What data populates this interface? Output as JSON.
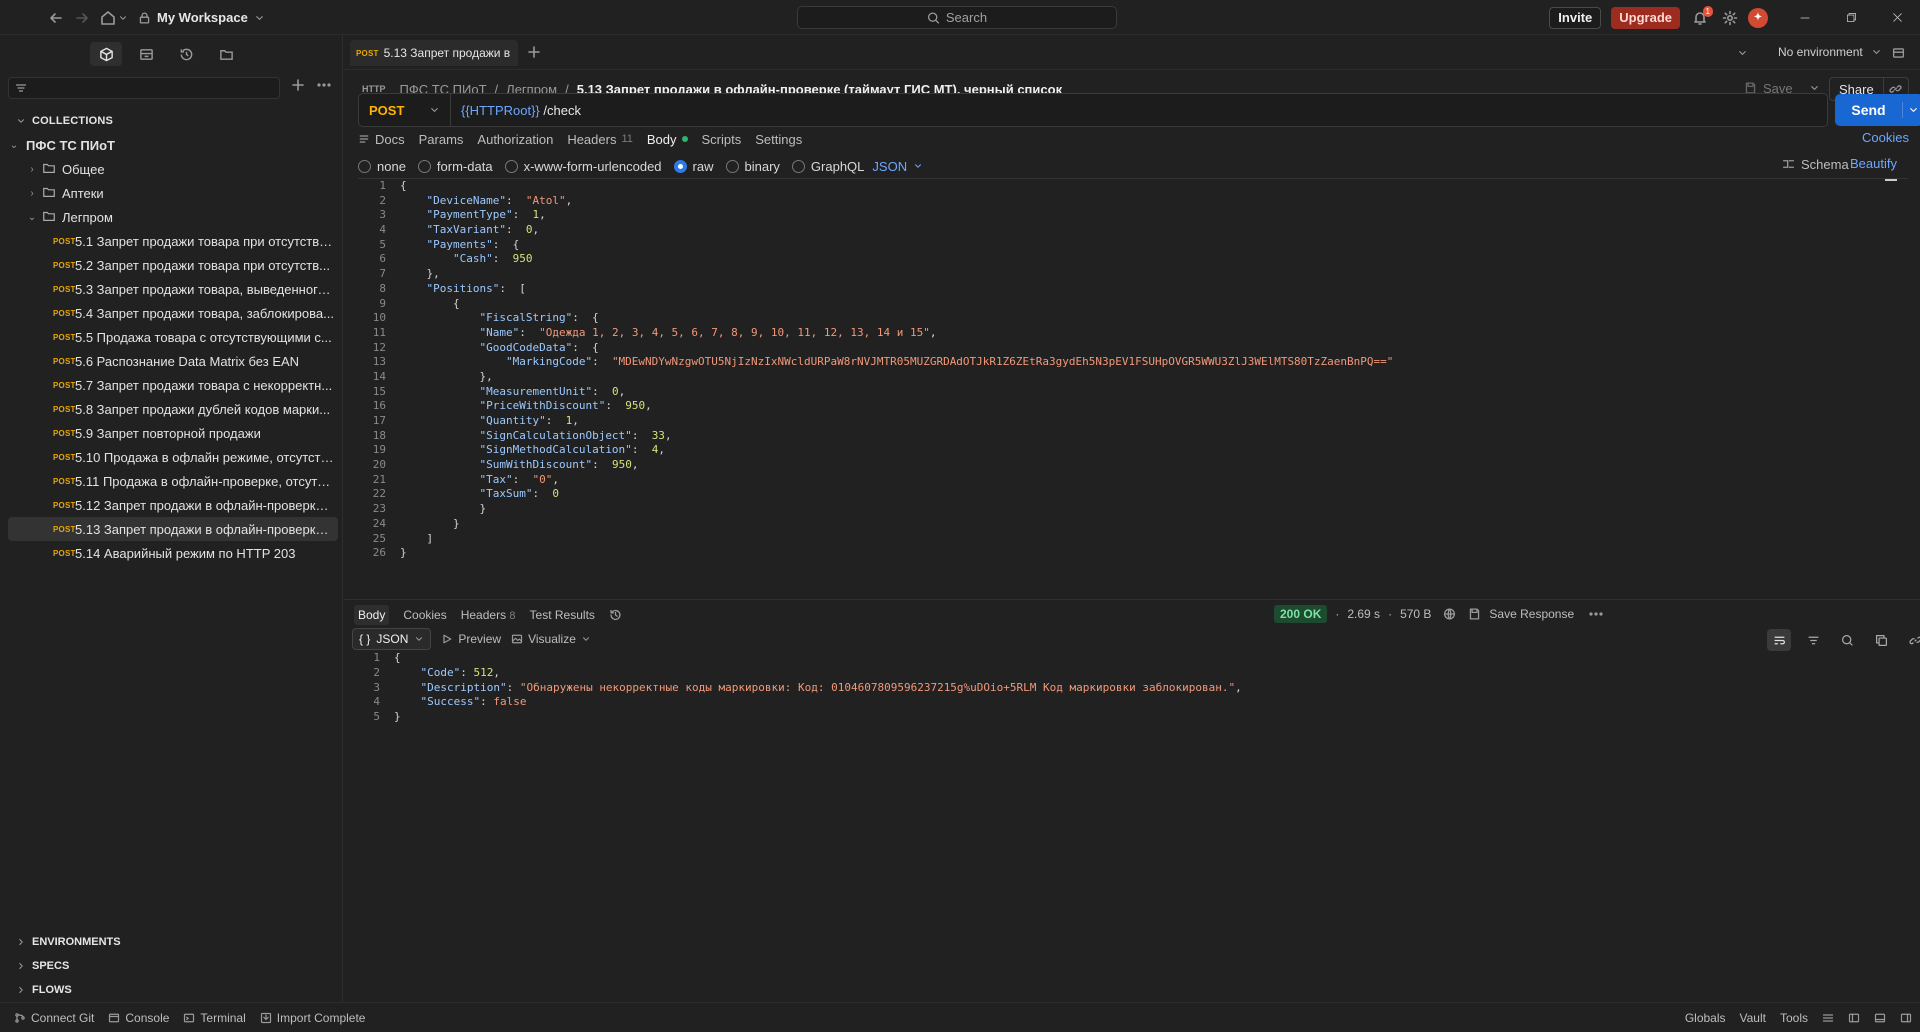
{
  "titlebar": {
    "workspace": "My Workspace",
    "search_placeholder": "Search",
    "invite": "Invite",
    "upgrade": "Upgrade",
    "notification_count": "1"
  },
  "sidebar": {
    "sections": {
      "collections": "COLLECTIONS",
      "environments": "ENVIRONMENTS",
      "specs": "SPECS",
      "flows": "FLOWS"
    },
    "collection_name": "ПФС ТС ПИоТ",
    "folders": [
      "Общее",
      "Аптеки",
      "Легпром"
    ],
    "method_label": "POST",
    "requests": [
      "5.1 Запрет продажи товара при отсутстви...",
      "5.2 Запрет продажи товара при отсутств...",
      "5.3 Запрет продажи товара, выведенного...",
      "5.4 Запрет продажи товара, заблокирова...",
      "5.5 Продажа товара с отсутствующими с...",
      "5.6 Распознание Data Matrix без EAN",
      "5.7 Запрет продажи товара с некорректн...",
      "5.8 Запрет продажи дублей кодов марки...",
      "5.9 Запрет повторной продажи",
      "5.10 Продажа в офлайн режиме, отсутств...",
      "5.11 Продажа в офлайн-проверке, отсутст...",
      "5.12 Запрет продажи в офлайн-проверке,...",
      "5.13 Запрет продажи в офлайн-проверке ...",
      "5.14 Аварийный режим по HTTP 203"
    ]
  },
  "tab": {
    "method": "POST",
    "title": "5.13 Запрет продажи в"
  },
  "environment": "No environment",
  "breadcrumb": {
    "protocol": "HTTP",
    "collection": "ПФС ТС ПИоТ",
    "folder": "Легпром",
    "current": "5.13 Запрет продажи в офлайн-проверке (таймаут ГИС МТ), черный список"
  },
  "actions": {
    "save": "Save",
    "share": "Share",
    "send": "Send",
    "cookies": "Cookies",
    "schema": "Schema",
    "beautify": "Beautify"
  },
  "request": {
    "method": "POST",
    "url_var": "{{HTTPRoot}}",
    "url_path": " /check"
  },
  "request_tabs": {
    "docs": "Docs",
    "params": "Params",
    "authorization": "Authorization",
    "headers": "Headers",
    "headers_count": "11",
    "body": "Body",
    "scripts": "Scripts",
    "settings": "Settings"
  },
  "body_types": {
    "none": "none",
    "form_data": "form-data",
    "urlencoded": "x-www-form-urlencoded",
    "raw": "raw",
    "binary": "binary",
    "graphql": "GraphQL",
    "language": "JSON"
  },
  "request_body": [
    [
      [
        "p",
        "{"
      ]
    ],
    [
      [
        "p",
        "    "
      ],
      [
        "k",
        "\"DeviceName\""
      ],
      [
        "p",
        ":  "
      ],
      [
        "s",
        "\"Atol\""
      ],
      [
        "p",
        ","
      ]
    ],
    [
      [
        "p",
        "    "
      ],
      [
        "k",
        "\"PaymentType\""
      ],
      [
        "p",
        ":  "
      ],
      [
        "n",
        "1"
      ],
      [
        "p",
        ","
      ]
    ],
    [
      [
        "p",
        "    "
      ],
      [
        "k",
        "\"TaxVariant\""
      ],
      [
        "p",
        ":  "
      ],
      [
        "n",
        "0"
      ],
      [
        "p",
        ","
      ]
    ],
    [
      [
        "p",
        "    "
      ],
      [
        "k",
        "\"Payments\""
      ],
      [
        "p",
        ":  {"
      ]
    ],
    [
      [
        "p",
        "        "
      ],
      [
        "k",
        "\"Cash\""
      ],
      [
        "p",
        ":  "
      ],
      [
        "n",
        "950"
      ]
    ],
    [
      [
        "p",
        "    },"
      ]
    ],
    [
      [
        "p",
        "    "
      ],
      [
        "k",
        "\"Positions\""
      ],
      [
        "p",
        ":  ["
      ]
    ],
    [
      [
        "p",
        "        {"
      ]
    ],
    [
      [
        "p",
        "            "
      ],
      [
        "k",
        "\"FiscalString\""
      ],
      [
        "p",
        ":  {"
      ]
    ],
    [
      [
        "p",
        "            "
      ],
      [
        "k",
        "\"Name\""
      ],
      [
        "p",
        ":  "
      ],
      [
        "s",
        "\"Одежда 1, 2, 3, 4, 5, 6, 7, 8, 9, 10, 11, 12, 13, 14 и 15\""
      ],
      [
        "p",
        ","
      ]
    ],
    [
      [
        "p",
        "            "
      ],
      [
        "k",
        "\"GoodCodeData\""
      ],
      [
        "p",
        ":  {"
      ]
    ],
    [
      [
        "p",
        "                "
      ],
      [
        "k",
        "\"MarkingCode\""
      ],
      [
        "p",
        ":  "
      ],
      [
        "s",
        "\"MDEwNDYwNzgwOTU5NjIzNzIxNWcldURPaW8rNVJMTR05MUZGRDAdOTJkR1Z6ZEtRa3gydEh5N3pEV1FSUHpOVGR5WWU3ZlJ3WElMTS80TzZaenBnPQ==\""
      ]
    ],
    [
      [
        "p",
        "            },"
      ]
    ],
    [
      [
        "p",
        "            "
      ],
      [
        "k",
        "\"MeasurementUnit\""
      ],
      [
        "p",
        ":  "
      ],
      [
        "n",
        "0"
      ],
      [
        "p",
        ","
      ]
    ],
    [
      [
        "p",
        "            "
      ],
      [
        "k",
        "\"PriceWithDiscount\""
      ],
      [
        "p",
        ":  "
      ],
      [
        "n",
        "950"
      ],
      [
        "p",
        ","
      ]
    ],
    [
      [
        "p",
        "            "
      ],
      [
        "k",
        "\"Quantity\""
      ],
      [
        "p",
        ":  "
      ],
      [
        "n",
        "1"
      ],
      [
        "p",
        ","
      ]
    ],
    [
      [
        "p",
        "            "
      ],
      [
        "k",
        "\"SignCalculationObject\""
      ],
      [
        "p",
        ":  "
      ],
      [
        "n",
        "33"
      ],
      [
        "p",
        ","
      ]
    ],
    [
      [
        "p",
        "            "
      ],
      [
        "k",
        "\"SignMethodCalculation\""
      ],
      [
        "p",
        ":  "
      ],
      [
        "n",
        "4"
      ],
      [
        "p",
        ","
      ]
    ],
    [
      [
        "p",
        "            "
      ],
      [
        "k",
        "\"SumWithDiscount\""
      ],
      [
        "p",
        ":  "
      ],
      [
        "n",
        "950"
      ],
      [
        "p",
        ","
      ]
    ],
    [
      [
        "p",
        "            "
      ],
      [
        "k",
        "\"Tax\""
      ],
      [
        "p",
        ":  "
      ],
      [
        "s",
        "\"0\""
      ],
      [
        "p",
        ","
      ]
    ],
    [
      [
        "p",
        "            "
      ],
      [
        "k",
        "\"TaxSum\""
      ],
      [
        "p",
        ":  "
      ],
      [
        "n",
        "0"
      ]
    ],
    [
      [
        "p",
        "            }"
      ]
    ],
    [
      [
        "p",
        "        }"
      ]
    ],
    [
      [
        "p",
        "    ]"
      ]
    ],
    [
      [
        "p",
        "}"
      ]
    ]
  ],
  "response_tabs": {
    "body": "Body",
    "cookies": "Cookies",
    "headers": "Headers",
    "headers_count": "8",
    "test_results": "Test Results"
  },
  "response_status": {
    "code": "200 OK",
    "time": "2.69 s",
    "size": "570 B",
    "save_response": "Save Response"
  },
  "response_view": {
    "format": "JSON",
    "preview": "Preview",
    "visualize": "Visualize"
  },
  "response_body": [
    [
      [
        "p",
        "{"
      ]
    ],
    [
      [
        "p",
        "    "
      ],
      [
        "k",
        "\"Code\""
      ],
      [
        "p",
        ": "
      ],
      [
        "n",
        "512"
      ],
      [
        "p",
        ","
      ]
    ],
    [
      [
        "p",
        "    "
      ],
      [
        "k",
        "\"Description\""
      ],
      [
        "p",
        ": "
      ],
      [
        "s",
        "\"Обнаружены некорректные коды маркировки: Код: 0104607809596237215g%uDOio+5RLM Код маркировки заблокирован.\""
      ],
      [
        "p",
        ","
      ]
    ],
    [
      [
        "p",
        "    "
      ],
      [
        "k",
        "\"Success\""
      ],
      [
        "p",
        ": "
      ],
      [
        "s",
        "false"
      ]
    ],
    [
      [
        "p",
        "}"
      ]
    ]
  ],
  "statusbar": {
    "connect_git": "Connect Git",
    "console": "Console",
    "terminal": "Terminal",
    "import_complete": "Import Complete",
    "globals": "Globals",
    "vault": "Vault",
    "tools": "Tools"
  },
  "colors": {
    "accent": "#1967d2",
    "method_post": "#ffb400",
    "upgrade": "#9c2b20",
    "status_ok": "#7fe0a5"
  }
}
